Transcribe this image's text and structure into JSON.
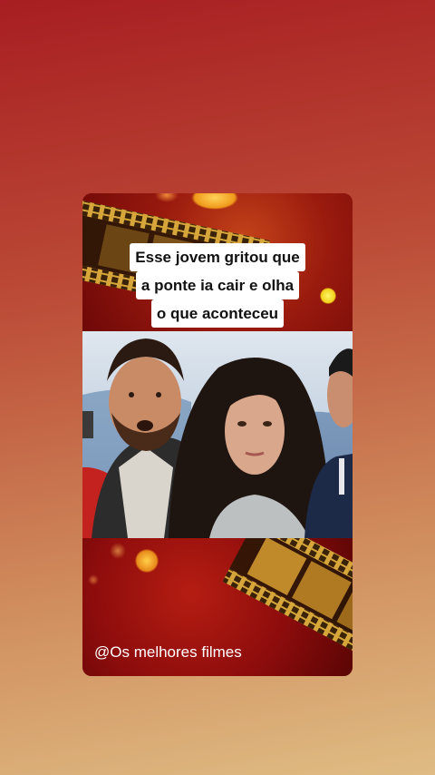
{
  "post": {
    "caption_lines": [
      "Esse jovem gritou que",
      "a ponte ia cair e olha",
      "o que aconteceu"
    ],
    "watermark": "@Os melhores filmes"
  },
  "colors": {
    "background_top": "#a81e22",
    "background_bottom": "#dfbc83",
    "panel_red": "#8e0d0d",
    "film_gold": "#d6a63a",
    "caption_bg": "#ffffff"
  },
  "icons": [
    "film-strip-icon"
  ]
}
